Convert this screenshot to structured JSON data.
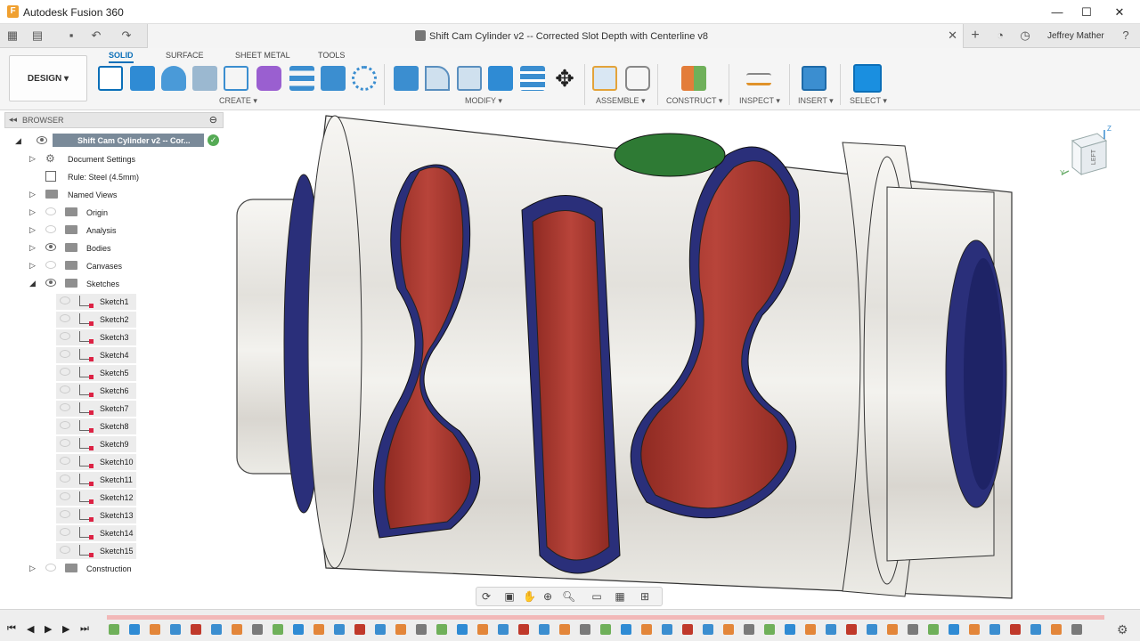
{
  "app": {
    "title": "Autodesk Fusion 360",
    "icon_letter": "F"
  },
  "window_controls": {
    "minimize": "—",
    "maximize": "☐",
    "close": "✕"
  },
  "document_tab": {
    "title": "Shift Cam Cylinder v2 -- Corrected Slot Depth with Centerline v8",
    "close": "✕"
  },
  "user": {
    "name": "Jeffrey Mather"
  },
  "workspace": {
    "label": "DESIGN ▾"
  },
  "workspace_tabs": [
    "SOLID",
    "SURFACE",
    "SHEET METAL",
    "TOOLS"
  ],
  "active_tab": "SOLID",
  "tool_groups": [
    "CREATE ▾",
    "MODIFY ▾",
    "ASSEMBLE ▾",
    "CONSTRUCT ▾",
    "INSPECT ▾",
    "INSERT ▾",
    "SELECT ▾"
  ],
  "browser": {
    "title": "BROWSER",
    "root": "Shift Cam Cylinder v2 -- Cor...",
    "nodes": [
      "Document Settings",
      "Rule: Steel (4.5mm)",
      "Named Views",
      "Origin",
      "Analysis",
      "Bodies",
      "Canvases",
      "Sketches"
    ],
    "sketches": [
      "Sketch1",
      "Sketch2",
      "Sketch3",
      "Sketch4",
      "Sketch5",
      "Sketch6",
      "Sketch7",
      "Sketch8",
      "Sketch9",
      "Sketch10",
      "Sketch11",
      "Sketch12",
      "Sketch13",
      "Sketch14",
      "Sketch15"
    ],
    "last": "Construction"
  },
  "viewcube": {
    "face": "LEFT",
    "axis_z": "Z",
    "axis_y": "Y"
  },
  "colors": {
    "accent": "#0b6fb8",
    "slot_red": "#a8362c",
    "slot_blue": "#2a2f7a",
    "hole_green": "#2e7a34",
    "metal": "#e9e7e2"
  },
  "icons": [
    "grid-icon",
    "file-icon",
    "save-icon",
    "undo-icon",
    "redo-icon",
    "add-tab-icon",
    "jobs-icon",
    "clock-icon",
    "help-icon",
    "orbit-icon",
    "pan-icon",
    "zoom-icon",
    "display-icon",
    "grid-settings-icon",
    "viewports-icon",
    "play-icon",
    "settings-gear-icon"
  ]
}
